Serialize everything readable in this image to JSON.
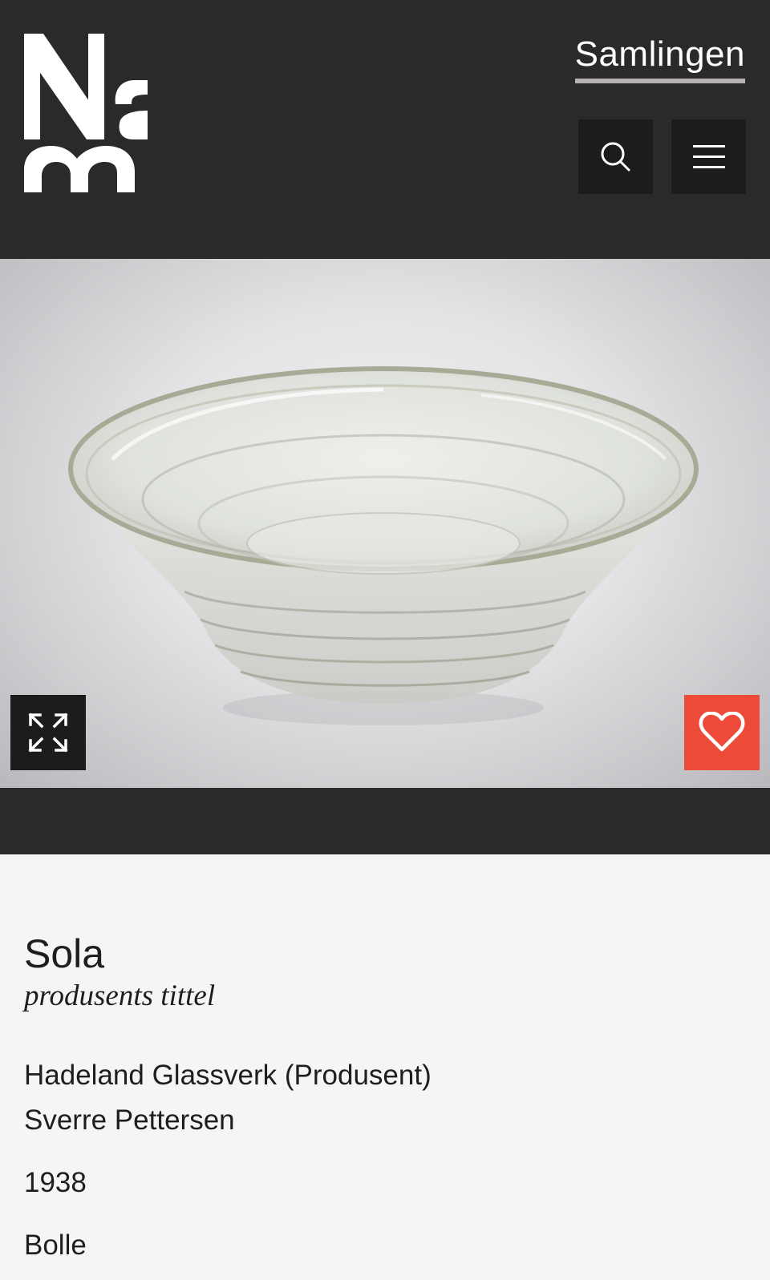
{
  "header": {
    "logo_text": "Nasjonalmuseet",
    "collection_link": "Samlingen",
    "search_icon": "search-icon",
    "menu_icon": "hamburger-menu-icon"
  },
  "hero": {
    "image_subject": "clear glass bowl",
    "expand_icon": "expand-icon",
    "favorite_icon": "heart-icon",
    "favorite_color": "#ee4a3a"
  },
  "artwork": {
    "title": "Sola",
    "title_note": "produsents tittel",
    "makers": [
      "Hadeland Glassverk (Produsent)",
      "Sverre Pettersen"
    ],
    "date": "1938",
    "object_type": "Bolle"
  }
}
